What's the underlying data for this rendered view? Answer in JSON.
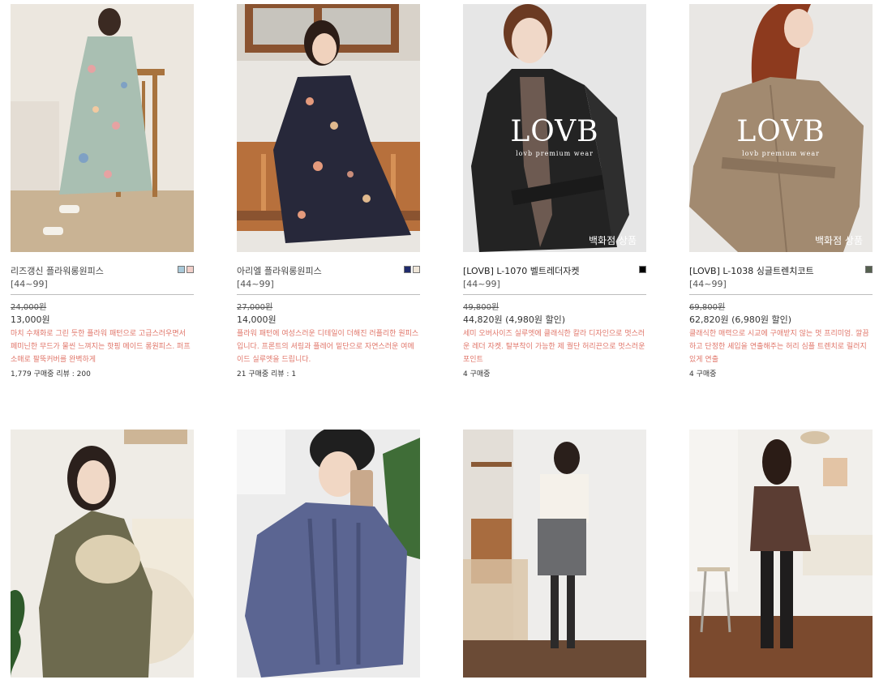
{
  "products": [
    {
      "name": "리즈갱신 플라워롱원피스",
      "size": "[44~99]",
      "original_price": "24,000원",
      "price": "13,000원",
      "description": "마치 수채화로 그린 듯한 플라워 패턴으로 고급스러우면서 페미닌한 무드가 물씬 느껴지는 핫핑 메이드 롱원피스. 퍼프 소매로 팔뚝커버를 완벽하게",
      "stats": "1,779 구매중   리뷰 : 200",
      "swatches": [
        "#a9c9d9",
        "#f1cfc9"
      ],
      "dept_label": "",
      "logo": "",
      "logo_sub": ""
    },
    {
      "name": "아리엘 플라워롱원피스",
      "size": "[44~99]",
      "original_price": "27,000원",
      "price": "14,000원",
      "description": "플라워 패턴에 여성스러운 디테일이 더해진 러플리한 원피스입니다. 프론트의 셔링과 플레어 밑단으로 자연스러운 여메이드 실루엣을 드립니다.",
      "stats": "21 구매중   리뷰 : 1",
      "swatches": [
        "#1f2a6b",
        "#efe6d8"
      ],
      "dept_label": "",
      "logo": "",
      "logo_sub": ""
    },
    {
      "name": "[LOVB] L-1070 벨트레더자켓",
      "size": "[44~99]",
      "original_price": "49,800원",
      "price": "44,820원 (4,980원 할인)",
      "description": "세미 오버사이즈 실루엣에 클래식한 칼라 디자인으로 멋스러운 레더 자켓. 탈부착이 가능한 제 퀄단 허리끈으로 멋스러운 포인트",
      "stats": "4 구매중",
      "swatches": [
        "#000000"
      ],
      "dept_label": "백화점 상품",
      "logo": "LOVB",
      "logo_sub": "lovb premium wear"
    },
    {
      "name": "[LOVB] L-1038 싱글트렌치코트",
      "size": "[44~99]",
      "original_price": "69,800원",
      "price": "62,820원 (6,980원 할인)",
      "description": "클래식한 매력으로 시교에 구애받지 않는 멋 프리미엄. 깔끔하고 단정한 셰입을 연출해주는 허리 심플 트렌치로 릴러지있게 연출",
      "stats": "4 구매중",
      "swatches": [
        "#55604f"
      ],
      "dept_label": "백화점 상품",
      "logo": "LOVB",
      "logo_sub": "lovb premium wear"
    }
  ],
  "colors": {
    "accent_text": "#e0766a",
    "divider": "#bdbdbd"
  }
}
